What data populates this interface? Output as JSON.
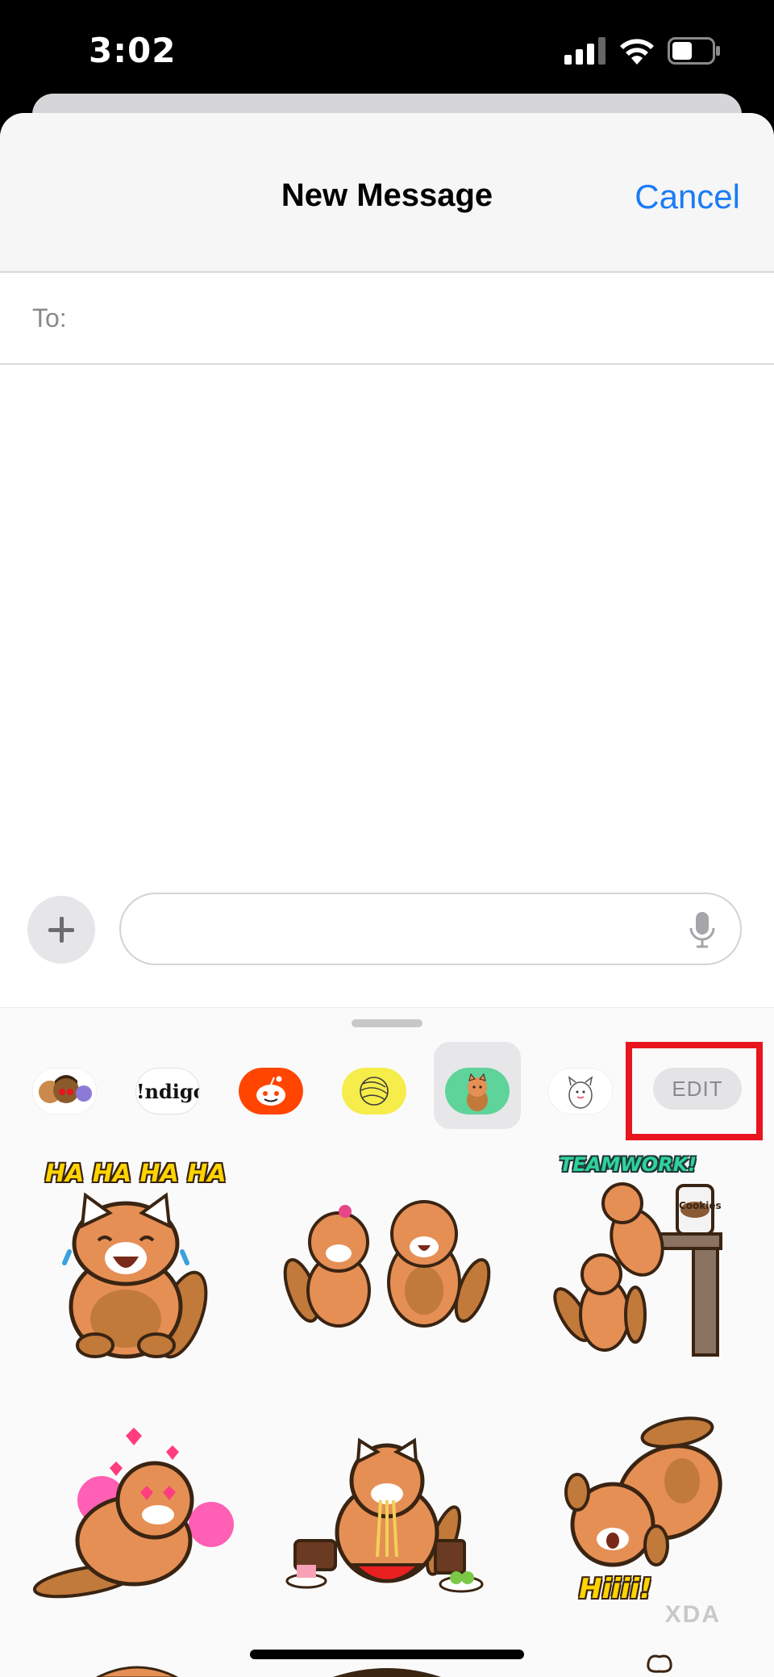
{
  "status_bar": {
    "time": "3:02",
    "signal_icon": "cellular-signal-icon",
    "wifi_icon": "wifi-icon",
    "battery_icon": "battery-icon"
  },
  "header": {
    "title": "New Message",
    "cancel_label": "Cancel",
    "accent_color": "#1a7cf5"
  },
  "recipient": {
    "label": "To:",
    "value": ""
  },
  "composer": {
    "add_icon": "plus-icon",
    "message_value": "",
    "mic_icon": "microphone-icon"
  },
  "app_drawer": {
    "apps": [
      {
        "name": "memoji-stickers"
      },
      {
        "name": "indigo",
        "label": "!ndigo"
      },
      {
        "name": "reddit"
      },
      {
        "name": "yellow-sphere-app"
      },
      {
        "name": "red-panda-stickers",
        "selected": true
      },
      {
        "name": "white-creature-stickers"
      }
    ],
    "edit_label": "EDIT",
    "highlight_color": "#e8141e"
  },
  "stickers": [
    {
      "name": "red-panda-laughing",
      "caption": "HA HA HA HA"
    },
    {
      "name": "red-panda-pair",
      "caption": ""
    },
    {
      "name": "red-panda-teamwork",
      "caption": "TEAMWORK!",
      "jar_label": "Cookies"
    },
    {
      "name": "red-panda-love",
      "caption": ""
    },
    {
      "name": "red-panda-eating-noodles",
      "caption": ""
    },
    {
      "name": "red-panda-hiii",
      "caption": "Hiiii!"
    }
  ],
  "watermark": "XDA"
}
